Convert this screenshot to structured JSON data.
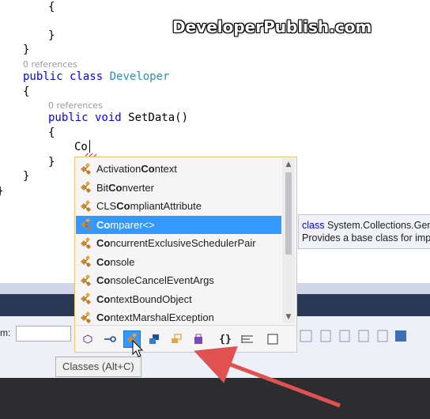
{
  "watermark": "DeveloperPublish.com",
  "code": {
    "line1": "{",
    "line2": "}",
    "line3": "}",
    "refs1": "0 references",
    "class_kw": "public class",
    "class_name": "Developer",
    "brace_open1": "{",
    "refs2": "0 references",
    "method_kw": "public void",
    "method_rest": " SetData()",
    "brace_open2": "{",
    "typed": "Co",
    "brace_close2": "}",
    "brace_close1": "}",
    "brace_close0": "}"
  },
  "completion": {
    "items": [
      {
        "pre": "Activation",
        "match": "Co",
        "post": "ntext",
        "selected": false
      },
      {
        "pre": "Bit",
        "match": "Co",
        "post": "nverter",
        "selected": false
      },
      {
        "pre": "CLS",
        "match": "Co",
        "post": "mpliantAttribute",
        "selected": false
      },
      {
        "pre": "",
        "match": "Co",
        "post": "mparer<>",
        "selected": true
      },
      {
        "pre": "",
        "match": "Co",
        "post": "ncurrentExclusiveSchedulerPair",
        "selected": false
      },
      {
        "pre": "",
        "match": "Co",
        "post": "nsole",
        "selected": false
      },
      {
        "pre": "",
        "match": "Co",
        "post": "nsoleCancelEventArgs",
        "selected": false
      },
      {
        "pre": "",
        "match": "Co",
        "post": "ntextBoundObject",
        "selected": false
      },
      {
        "pre": "",
        "match": "Co",
        "post": "ntextMarshalException",
        "selected": false
      }
    ],
    "filter_icons": [
      "cube-icon",
      "key-icon",
      "class-icon",
      "struct-icon",
      "enum-icon",
      "delegate-icon",
      "braces-icon",
      "list-icon",
      "square-icon"
    ]
  },
  "tooltip": {
    "kw": "class",
    "type": " System.Collections.Generic",
    "desc": "Provides a base class for implementations"
  },
  "classes_tip": "Classes (Alt+C)",
  "toolbar": {
    "label": "m:"
  },
  "colors": {
    "keyword": "#0000ff",
    "type": "#2b91af",
    "selection": "#3399ff",
    "arrow": "#e05252"
  }
}
